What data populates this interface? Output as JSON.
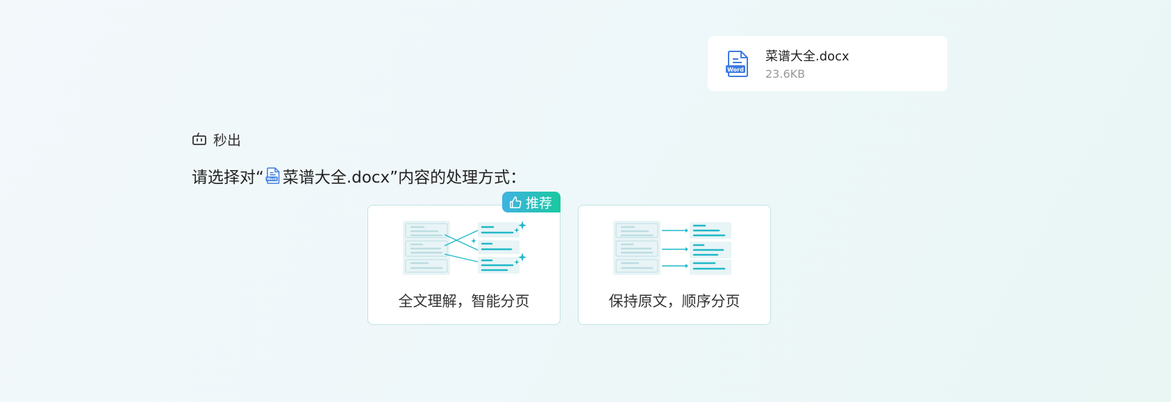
{
  "file": {
    "name": "菜谱大全.docx",
    "size": "23.6KB",
    "icon": "word-file-icon"
  },
  "assistant": {
    "name": "秒出",
    "icon": "bot-icon"
  },
  "prompt": {
    "prefix": "请选择对“",
    "file_name": "菜谱大全.docx",
    "suffix": "”内容的处理方式："
  },
  "options": [
    {
      "label": "全文理解，智能分页",
      "badge": "推荐",
      "badge_icon": "thumbs-up-icon"
    },
    {
      "label": "保持原文，顺序分页"
    }
  ],
  "colors": {
    "accent": "#1fb8c8",
    "badge_start": "#3fb3e2",
    "badge_end": "#19c8a0",
    "word_blue": "#3a7be0"
  }
}
